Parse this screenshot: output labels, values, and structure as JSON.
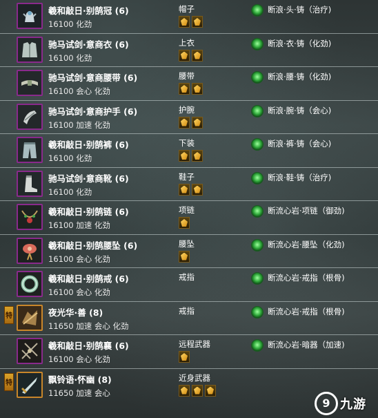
{
  "items": [
    {
      "name": "羲和敲日·别鹄冠 (6)",
      "stats": "16100 化劲",
      "slot": "帽子",
      "sockets": 2,
      "enhance": "断浪·头·铸（治疗)",
      "icon": "hat-icon",
      "badge": null
    },
    {
      "name": "驰马试剑·意商衣 (6)",
      "stats": "16100 化劲",
      "slot": "上衣",
      "sockets": 2,
      "enhance": "断浪·衣·铸（化劲)",
      "icon": "robe-icon",
      "badge": null
    },
    {
      "name": "驰马试剑·意商腰带 (6)",
      "stats": "16100 会心 化劲",
      "slot": "腰带",
      "sockets": 2,
      "enhance": "断浪·腰·铸（化劲)",
      "icon": "belt-icon",
      "badge": null
    },
    {
      "name": "驰马试剑·意商护手 (6)",
      "stats": "16100 加速 化劲",
      "slot": "护腕",
      "sockets": 2,
      "enhance": "断浪·腕·铸（会心)",
      "icon": "bracer-icon",
      "badge": null
    },
    {
      "name": "羲和敲日·别鹄裤 (6)",
      "stats": "16100 化劲",
      "slot": "下装",
      "sockets": 2,
      "enhance": "断浪·裤·铸（会心)",
      "icon": "pants-icon",
      "badge": null
    },
    {
      "name": "驰马试剑·意商靴 (6)",
      "stats": "16100 化劲",
      "slot": "鞋子",
      "sockets": 2,
      "enhance": "断浪·鞋·铸（治疗)",
      "icon": "boots-icon",
      "badge": null
    },
    {
      "name": "羲和敲日·别鹄链 (6)",
      "stats": "16100 加速 化劲",
      "slot": "项链",
      "sockets": 1,
      "enhance": "断流心岩·项链（御劲)",
      "icon": "necklace-icon",
      "badge": null
    },
    {
      "name": "羲和敲日·别鹄腰坠 (6)",
      "stats": "16100 会心 化劲",
      "slot": "腰坠",
      "sockets": 1,
      "enhance": "断流心岩·腰坠（化劲)",
      "icon": "pendant-icon",
      "badge": null
    },
    {
      "name": "羲和敲日·别鹄戒 (6)",
      "stats": "16100 会心 化劲",
      "slot": "戒指",
      "sockets": 0,
      "enhance": "断流心岩·戒指（根骨)",
      "icon": "ring-icon",
      "badge": null
    },
    {
      "name": "夜光华·善 (8)",
      "stats": "11650 加速 会心 化劲",
      "slot": "戒指",
      "sockets": 0,
      "enhance": "断流心岩·戒指（根骨)",
      "icon": "ring-special-icon",
      "badge": "特"
    },
    {
      "name": "羲和敲日·别鹄襄 (6)",
      "stats": "16100 会心 化劲",
      "slot": "远程武器",
      "sockets": 1,
      "enhance": "断流心岩·暗器（加速)",
      "icon": "ranged-weapon-icon",
      "badge": null
    },
    {
      "name": "飘铃语·怀幽 (8)",
      "stats": "11650 加速 会心",
      "slot": "近身武器",
      "sockets": 3,
      "enhance": "",
      "icon": "melee-weapon-icon",
      "badge": "特"
    }
  ],
  "watermark": {
    "text": "九游"
  }
}
